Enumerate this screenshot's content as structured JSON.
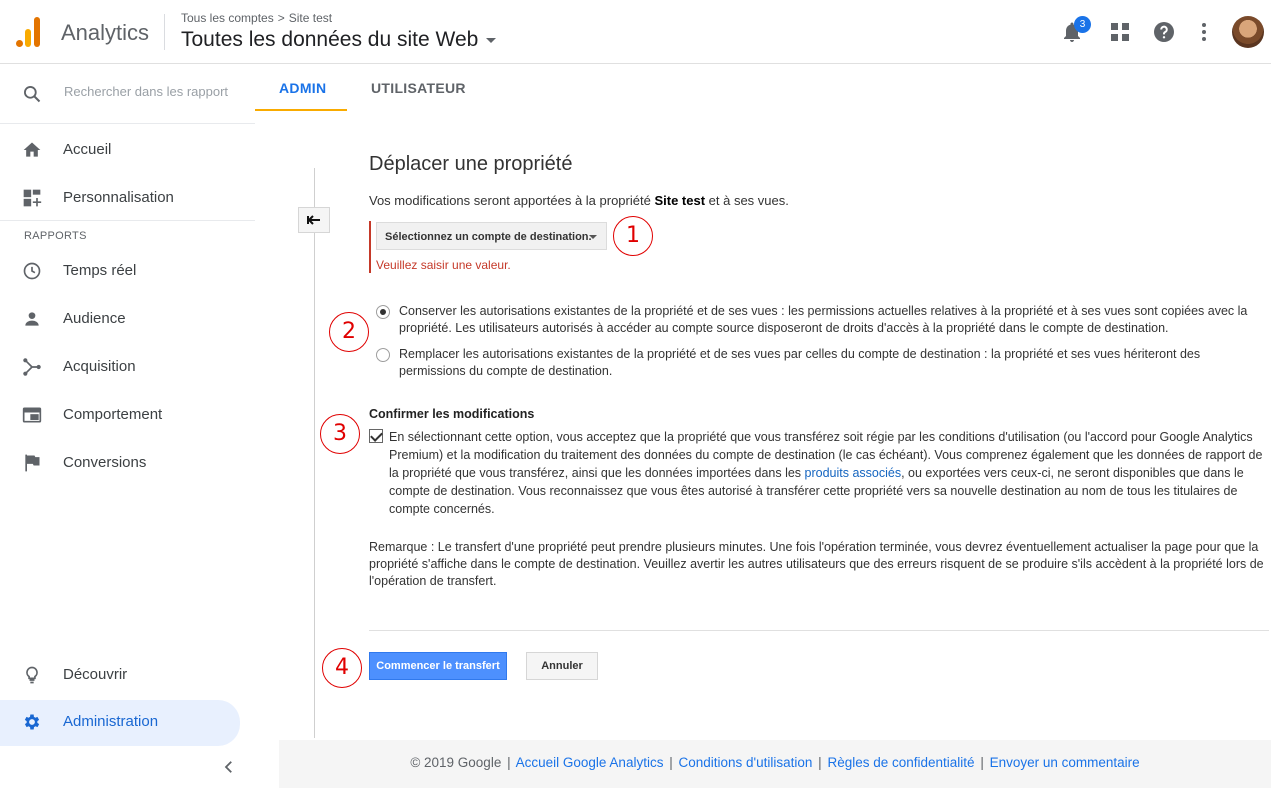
{
  "header": {
    "app_name": "Analytics",
    "breadcrumb_root": "Tous les comptes",
    "breadcrumb_sep": ">",
    "breadcrumb_leaf": "Site test",
    "property_title": "Toutes les données du site Web",
    "notifications_count": "3"
  },
  "sidebar": {
    "search_placeholder": "Rechercher dans les rapport",
    "home": "Accueil",
    "customization": "Personnalisation",
    "reports_section": "RAPPORTS",
    "realtime": "Temps réel",
    "audience": "Audience",
    "acquisition": "Acquisition",
    "behavior": "Comportement",
    "conversions": "Conversions",
    "discover": "Découvrir",
    "admin": "Administration"
  },
  "tabs": {
    "admin": "ADMIN",
    "user": "UTILISATEUR"
  },
  "form": {
    "title": "Déplacer une propriété",
    "intro_prefix": "Vos modifications seront apportées à la propriété ",
    "intro_property": "Site test",
    "intro_suffix": " et à ses vues.",
    "select_label": "Sélectionnez un compte de destination.",
    "error_message": "Veuillez saisir une valeur.",
    "radio_keep": "Conserver les autorisations existantes de la propriété et de ses vues : les permissions actuelles relatives à la propriété et à ses vues sont copiées avec la propriété. Les utilisateurs autorisés à accéder au compte source disposeront de droits d'accès à la propriété dans le compte de destination.",
    "radio_replace": "Remplacer les autorisations existantes de la propriété et de ses vues par celles du compte de destination : la propriété et ses vues hériteront des permissions du compte de destination.",
    "confirm_heading": "Confirmer les modifications",
    "confirm_text_1": "En sélectionnant cette option, vous acceptez que la propriété que vous transférez soit régie par les conditions d'utilisation (ou l'accord pour Google Analytics Premium) et la modification du traitement des données du compte de destination (le cas échéant). Vous comprenez également que les données de rapport de la propriété que vous transférez, ainsi que les données importées dans les ",
    "confirm_link": "produits associés",
    "confirm_text_2": ", ou exportées vers ceux-ci, ne seront disponibles que dans le compte de destination. Vous reconnaissez que vous êtes autorisé à transférer cette propriété vers sa nouvelle destination au nom de tous les titulaires de compte concernés.",
    "note": "Remarque : Le transfert d'une propriété peut prendre plusieurs minutes. Une fois l'opération terminée, vous devrez éventuellement actualiser la page pour que la propriété s'affiche dans le compte de destination. Veuillez avertir les autres utilisateurs que des erreurs risquent de se produire s'ils accèdent à la propriété lors de l'opération de transfert.",
    "start_button": "Commencer le transfert",
    "cancel_button": "Annuler"
  },
  "annotations": {
    "n1": "1",
    "n2": "2",
    "n3": "3",
    "n4": "4"
  },
  "footer": {
    "copyright": "© 2019 Google",
    "home_link": "Accueil Google Analytics",
    "terms_link": "Conditions d'utilisation",
    "privacy_link": "Règles de confidentialité",
    "feedback_link": "Envoyer un commentaire",
    "sep": "|"
  },
  "colors": {
    "accent": "#1a73e8",
    "tab_underline": "#f9ab00",
    "error": "#c53929",
    "annotation": "#e00000",
    "primary_button": "#4d90fe"
  }
}
